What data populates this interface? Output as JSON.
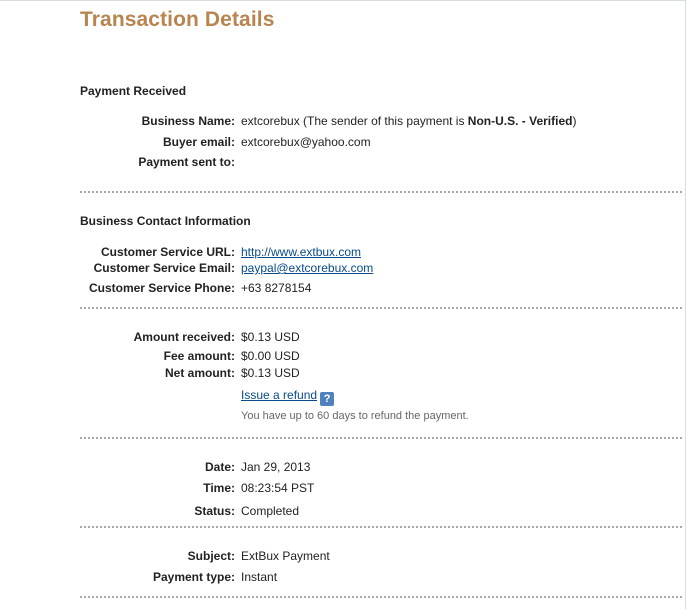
{
  "title": "Transaction Details",
  "payment_received": {
    "heading": "Payment Received",
    "business_name_label": "Business Name:",
    "business_name_value": "extcorebux",
    "sender_note_prefix": "(The sender of this payment is ",
    "sender_status": "Non-U.S. - Verified",
    "sender_note_suffix": ")",
    "buyer_email_label": "Buyer email:",
    "buyer_email_value": "extcorebux@yahoo.com",
    "payment_sent_to_label": "Payment sent to:"
  },
  "contact": {
    "heading": "Business Contact Information",
    "url_label": "Customer Service URL:",
    "url_value": "http://www.extbux.com",
    "email_label": "Customer Service Email:",
    "email_value": "paypal@extcorebux.com",
    "phone_label": "Customer Service Phone:",
    "phone_value": "+63 8278154"
  },
  "amounts": {
    "received_label": "Amount received:",
    "received_value": "$0.13 USD",
    "fee_label": "Fee amount:",
    "fee_value": "$0.00 USD",
    "net_label": "Net amount:",
    "net_value": "$0.13 USD",
    "refund_link": "Issue a refund",
    "help_icon": "question-mark",
    "refund_note": "You have up to 60 days to refund the payment."
  },
  "details": {
    "date_label": "Date:",
    "date_value": "Jan 29, 2013",
    "time_label": "Time:",
    "time_value": "08:23:54 PST",
    "status_label": "Status:",
    "status_value": "Completed"
  },
  "subject": {
    "subject_label": "Subject:",
    "subject_value": "ExtBux Payment",
    "type_label": "Payment type:",
    "type_value": "Instant"
  },
  "colors": {
    "title": "#b8844f",
    "link": "#084b8a",
    "help_icon": "#4f81bd"
  }
}
